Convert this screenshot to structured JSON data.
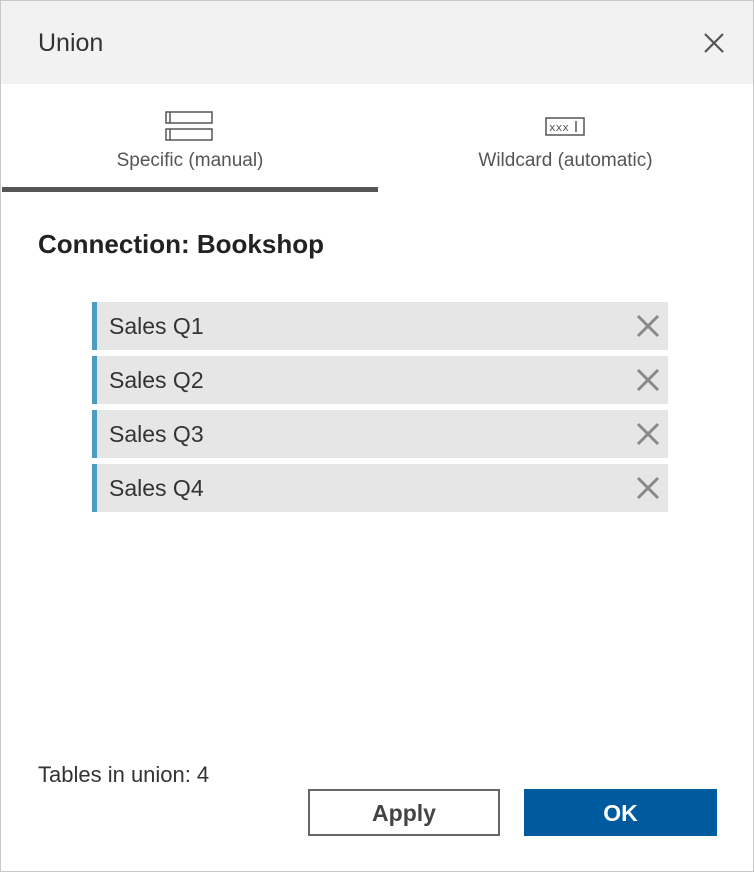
{
  "dialog": {
    "title": "Union",
    "close_icon": "close-icon"
  },
  "tabs": [
    {
      "label": "Specific (manual)",
      "icon": "stacked-tables-icon",
      "active": true
    },
    {
      "label": "Wildcard (automatic)",
      "icon": "wildcard-icon",
      "active": false
    }
  ],
  "wildcard_icon_text": "xxx",
  "connection": {
    "title": "Connection: Bookshop"
  },
  "tables": [
    {
      "name": "Sales Q1",
      "remove_icon": "remove-icon"
    },
    {
      "name": "Sales Q2",
      "remove_icon": "remove-icon"
    },
    {
      "name": "Sales Q3",
      "remove_icon": "remove-icon"
    },
    {
      "name": "Sales Q4",
      "remove_icon": "remove-icon"
    }
  ],
  "footer": {
    "tables_count_label": "Tables in union:",
    "tables_count": "4",
    "apply_label": "Apply",
    "ok_label": "OK"
  },
  "colors": {
    "accent": "#4a9ec2",
    "primary_button": "#005a9e",
    "titlebar_bg": "#f2f2f2",
    "item_bg": "#e6e6e6"
  }
}
